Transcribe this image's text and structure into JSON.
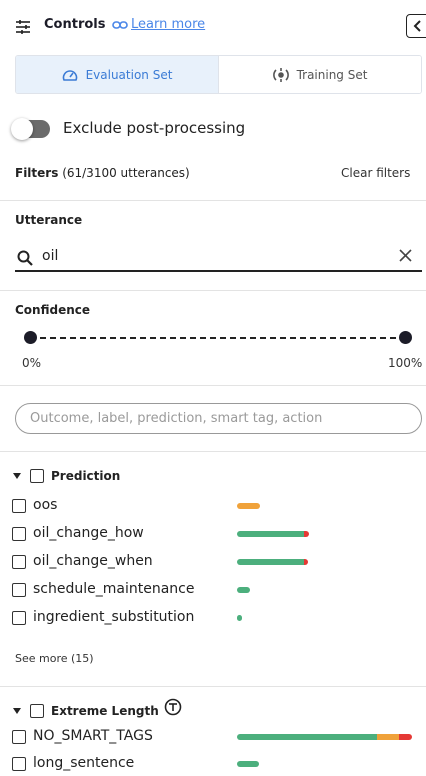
{
  "header": {
    "title": "Controls",
    "link_label": "Learn more"
  },
  "tabs": [
    {
      "label": "Evaluation Set",
      "active": true,
      "icon": "gauge-icon"
    },
    {
      "label": "Training Set",
      "active": false,
      "icon": "training-icon"
    }
  ],
  "toggle": {
    "label": "Exclude post-processing",
    "on": false
  },
  "filters": {
    "title": "Filters",
    "count": "(61/3100 utterances)",
    "clear_label": "Clear filters"
  },
  "utterance": {
    "title": "Utterance",
    "value": "oil"
  },
  "confidence": {
    "title": "Confidence",
    "min_label": "0%",
    "max_label": "100%",
    "range": [
      0,
      100
    ]
  },
  "search": {
    "placeholder": "Outcome, label, prediction, smart tag, action"
  },
  "prediction": {
    "title": "Prediction",
    "items": [
      {
        "label": "oos",
        "segments": [
          {
            "color": "#f0a23a",
            "fraction": 0.13
          }
        ]
      },
      {
        "label": "oil_change_how",
        "segments": [
          {
            "color": "#4caf7d",
            "fraction": 0.37
          },
          {
            "color": "#e53935",
            "fraction": 0.03
          }
        ]
      },
      {
        "label": "oil_change_when",
        "segments": [
          {
            "color": "#4caf7d",
            "fraction": 0.37
          },
          {
            "color": "#e53935",
            "fraction": 0.02
          }
        ]
      },
      {
        "label": "schedule_maintenance",
        "segments": [
          {
            "color": "#4caf7d",
            "fraction": 0.07
          }
        ]
      },
      {
        "label": "ingredient_substitution",
        "segments": [
          {
            "color": "#4caf7d",
            "fraction": 0.03
          }
        ]
      }
    ],
    "see_more": "See more (15)"
  },
  "extreme_length": {
    "title": "Extreme Length",
    "items": [
      {
        "label": "NO_SMART_TAGS",
        "segments": [
          {
            "color": "#4caf7d",
            "fraction": 0.78
          },
          {
            "color": "#f0a23a",
            "fraction": 0.12
          },
          {
            "color": "#e53935",
            "fraction": 0.07
          }
        ]
      },
      {
        "label": "long_sentence",
        "segments": [
          {
            "color": "#4caf7d",
            "fraction": 0.12
          }
        ]
      }
    ]
  }
}
